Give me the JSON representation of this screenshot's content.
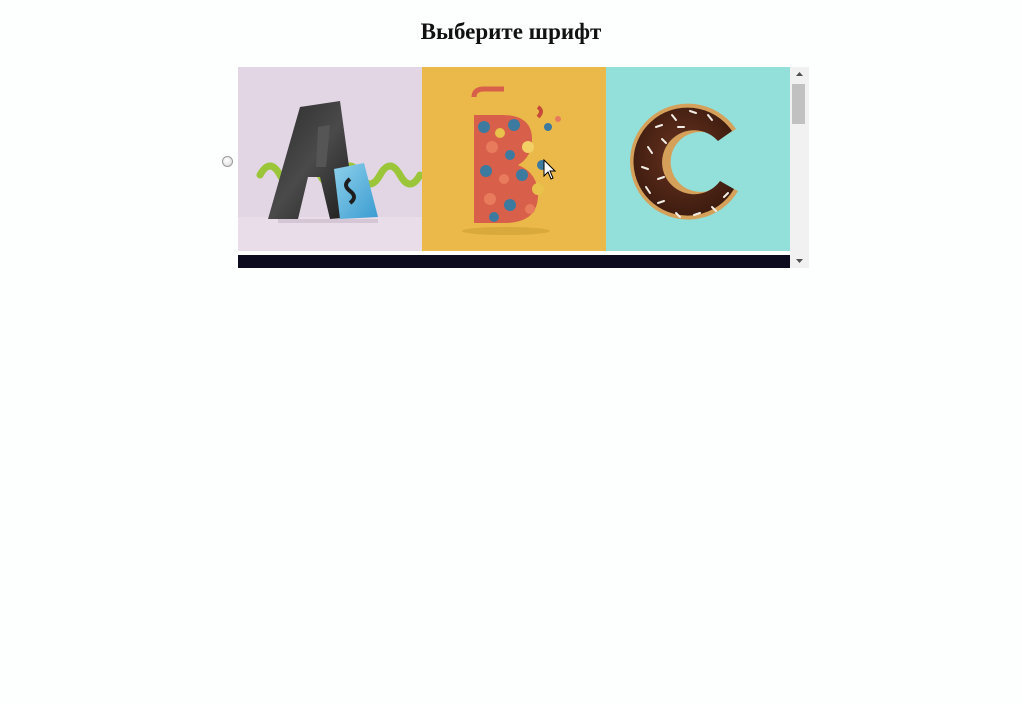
{
  "page": {
    "title": "Выберите шрифт"
  },
  "gallery": {
    "selected": false,
    "letters": [
      "A",
      "B",
      "C"
    ],
    "tile_colors": {
      "a_background": "#e2d5e4",
      "b_background": "#eab949",
      "c_background": "#92e0d9"
    },
    "scrollbar": {
      "track_color": "#f1f1f1",
      "thumb_color": "#c1c1c1"
    }
  }
}
